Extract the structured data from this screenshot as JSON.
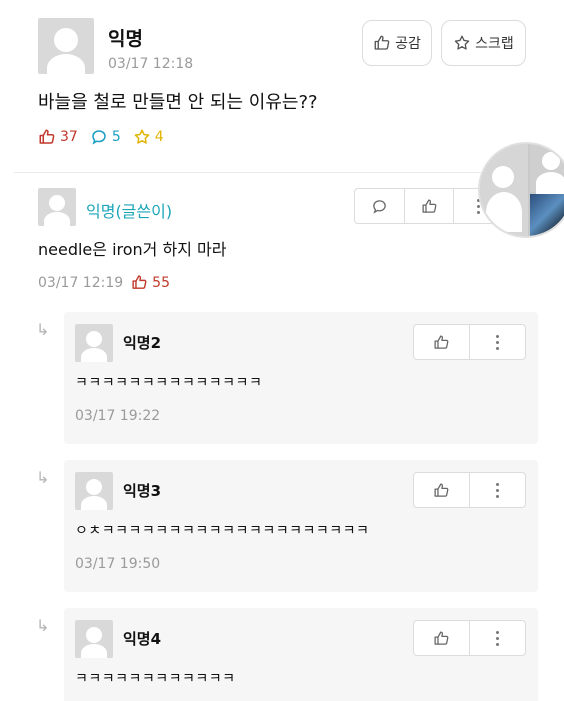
{
  "post": {
    "author": "익명",
    "time": "03/17 12:18",
    "like_button_label": "공감",
    "scrap_button_label": "스크랩",
    "title": "바늘을 철로 만들면 안 되는 이유는??",
    "stats": {
      "likes": "37",
      "comments": "5",
      "scraps": "4"
    }
  },
  "comment": {
    "author": "익명(글쓴이)",
    "body": "needle은 iron거 하지 마라",
    "time": "03/17 12:19",
    "likes": "55"
  },
  "replies": [
    {
      "author": "익명2",
      "body": "ㅋㅋㅋㅋㅋㅋㅋㅋㅋㅋㅋㅋㅋㅋ",
      "time": "03/17 19:22"
    },
    {
      "author": "익명3",
      "body": "ㅇㅊㅋㅋㅋㅋㅋㅋㅋㅋㅋㅋㅋㅋㅋㅋㅋㅋㅋㅋㅋㅋ",
      "time": "03/17 19:50"
    },
    {
      "author": "익명4",
      "body": "ㅋㅋㅋㅋㅋㅋㅋㅋㅋㅋㅋㅋ",
      "time": ""
    }
  ],
  "icons": {
    "thumb": "thumbs-up-icon",
    "comment": "speech-bubble-icon",
    "star": "star-icon",
    "more": "more-vertical-icon",
    "reply": "reply-arrow-icon"
  },
  "colors": {
    "like": "#c0392b",
    "comment": "#1a9fc4",
    "scrap": "#e0b400",
    "writer": "#1aa5b8"
  }
}
